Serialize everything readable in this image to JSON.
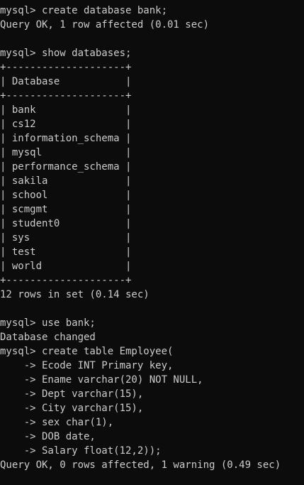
{
  "terminal": {
    "lines": [
      "mysql> create database bank;",
      "Query OK, 1 row affected (0.01 sec)",
      "",
      "mysql> show databases;",
      "+--------------------+",
      "| Database           |",
      "+--------------------+",
      "| bank               |",
      "| cs12               |",
      "| information_schema |",
      "| mysql              |",
      "| performance_schema |",
      "| sakila             |",
      "| school             |",
      "| scmgmt             |",
      "| student0           |",
      "| sys                |",
      "| test               |",
      "| world              |",
      "+--------------------+",
      "12 rows in set (0.14 sec)",
      "",
      "mysql> use bank;",
      "Database changed",
      "mysql> create table Employee(",
      "    -> Ecode INT Primary key,",
      "    -> Ename varchar(20) NOT NULL,",
      "    -> Dept varchar(15),",
      "    -> City varchar(15),",
      "    -> sex char(1),",
      "    -> DOB date,",
      "    -> Salary float(12,2));",
      "Query OK, 0 rows affected, 1 warning (0.49 sec)"
    ]
  }
}
